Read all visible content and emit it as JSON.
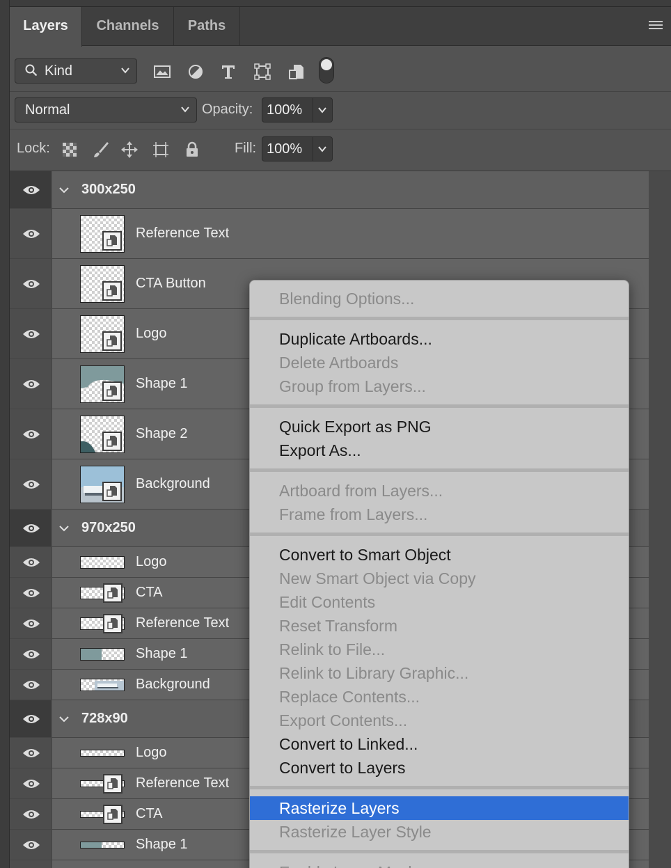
{
  "tabs": [
    {
      "label": "Layers",
      "active": true
    },
    {
      "label": "Channels",
      "active": false
    },
    {
      "label": "Paths",
      "active": false
    }
  ],
  "filter": {
    "kind_label": "Kind",
    "icons": [
      "image-filter-icon",
      "adjustment-filter-icon",
      "type-filter-icon",
      "shape-filter-icon",
      "smart-object-filter-icon",
      "filter-toggle"
    ]
  },
  "blend": {
    "mode": "Normal",
    "opacity_label": "Opacity:",
    "opacity": "100%"
  },
  "lock": {
    "label": "Lock:",
    "fill_label": "Fill:",
    "fill": "100%",
    "icons": [
      "lock-transparent-pixels-icon",
      "lock-image-pixels-icon",
      "lock-position-icon",
      "lock-artboard-icon",
      "lock-all-icon"
    ]
  },
  "layers": {
    "g1": {
      "name": "300x250",
      "items": [
        "Reference Text",
        "CTA Button",
        "Logo",
        "Shape 1",
        "Shape 2",
        "Background"
      ]
    },
    "g2": {
      "name": "970x250",
      "items": [
        "Logo",
        "CTA",
        "Reference Text",
        "Shape 1",
        "Background"
      ]
    },
    "g3": {
      "name": "728x90",
      "items": [
        "Logo",
        "Reference Text",
        "CTA",
        "Shape 1"
      ]
    }
  },
  "context_menu": {
    "items": [
      {
        "label": "Blending Options...",
        "enabled": false
      },
      {
        "label": "Duplicate Artboards...",
        "enabled": true
      },
      {
        "label": "Delete Artboards",
        "enabled": false
      },
      {
        "label": "Group from Layers...",
        "enabled": false
      },
      {
        "label": "Quick Export as PNG",
        "enabled": true
      },
      {
        "label": "Export As...",
        "enabled": true
      },
      {
        "label": "Artboard from Layers...",
        "enabled": false
      },
      {
        "label": "Frame from Layers...",
        "enabled": false
      },
      {
        "label": "Convert to Smart Object",
        "enabled": true
      },
      {
        "label": "New Smart Object via Copy",
        "enabled": false
      },
      {
        "label": "Edit Contents",
        "enabled": false
      },
      {
        "label": "Reset Transform",
        "enabled": false
      },
      {
        "label": "Relink to File...",
        "enabled": false
      },
      {
        "label": "Relink to Library Graphic...",
        "enabled": false
      },
      {
        "label": "Replace Contents...",
        "enabled": false
      },
      {
        "label": "Export Contents...",
        "enabled": false
      },
      {
        "label": "Convert to Linked...",
        "enabled": true
      },
      {
        "label": "Convert to Layers",
        "enabled": true
      },
      {
        "label": "Rasterize Layers",
        "enabled": true,
        "highlighted": true
      },
      {
        "label": "Rasterize Layer Style",
        "enabled": false
      },
      {
        "label": "Enable Layer Mask",
        "enabled": false
      }
    ]
  },
  "colors": {
    "highlight": "#2f6ed6",
    "panel": "#535353",
    "menu": "#c8c8c8"
  }
}
